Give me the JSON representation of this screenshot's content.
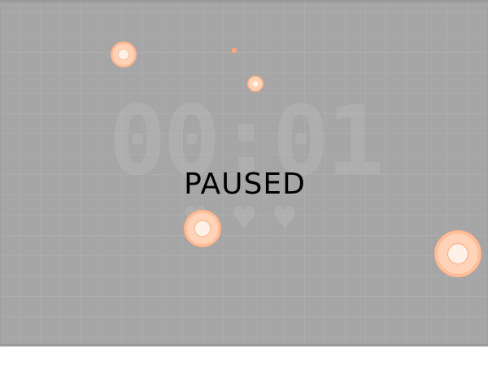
{
  "hud": {
    "timer": "00:01",
    "status": "PAUSED",
    "lives": [
      "♥",
      "♥",
      "♥"
    ]
  },
  "colors": {
    "background": "#a6a6a6",
    "target_outer": "#ffc29c",
    "target_inner": "#fff1e8"
  }
}
